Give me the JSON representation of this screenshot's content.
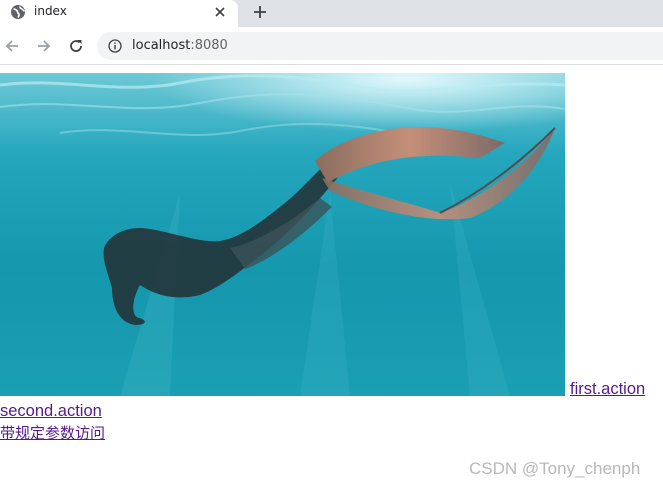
{
  "browser": {
    "tab": {
      "title": "index",
      "favicon": "globe-icon",
      "close_icon": "close-icon"
    },
    "new_tab_icon": "plus-icon",
    "toolbar": {
      "back_icon": "arrow-left-icon",
      "forward_icon": "arrow-right-icon",
      "reload_icon": "reload-icon",
      "info_icon": "info-icon"
    },
    "address": {
      "host": "localhost",
      "port": ":8080"
    }
  },
  "page": {
    "image_subject": "underwater freediver with monofin in turquoise water",
    "links": {
      "first": "first.action",
      "second": "second.action",
      "third": "带规定参数访问"
    },
    "link_color": "#551a8b"
  },
  "watermark": "CSDN @Tony_chenph"
}
